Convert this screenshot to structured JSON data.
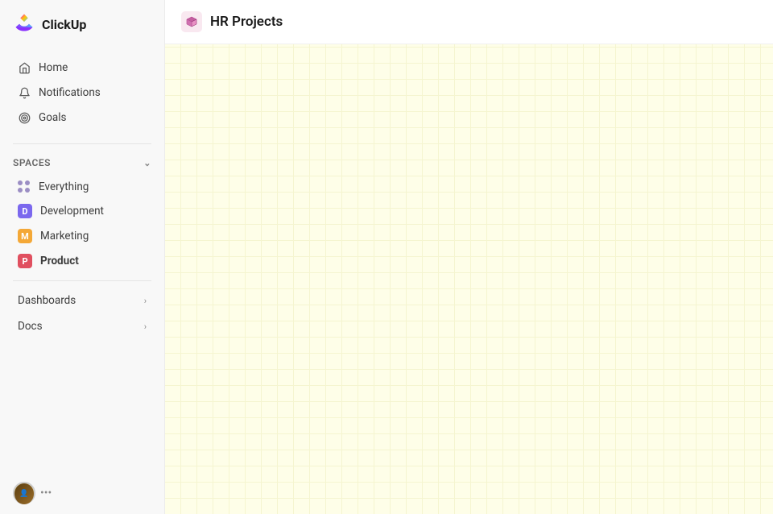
{
  "app": {
    "name": "ClickUp"
  },
  "sidebar": {
    "logo_text": "ClickUp",
    "nav_items": [
      {
        "id": "home",
        "label": "Home",
        "icon": "home-icon"
      },
      {
        "id": "notifications",
        "label": "Notifications",
        "icon": "bell-icon"
      },
      {
        "id": "goals",
        "label": "Goals",
        "icon": "goals-icon"
      }
    ],
    "spaces_label": "Spaces",
    "spaces": [
      {
        "id": "everything",
        "label": "Everything",
        "icon": "grid-icon",
        "color": null
      },
      {
        "id": "development",
        "label": "Development",
        "letter": "D",
        "color": "#7b68ee"
      },
      {
        "id": "marketing",
        "label": "Marketing",
        "letter": "M",
        "color": "#f4a837"
      },
      {
        "id": "product",
        "label": "Product",
        "letter": "P",
        "color": "#e04f5f",
        "active": true
      }
    ],
    "collapsibles": [
      {
        "id": "dashboards",
        "label": "Dashboards"
      },
      {
        "id": "docs",
        "label": "Docs"
      }
    ]
  },
  "main": {
    "header_title": "HR Projects",
    "header_icon": "hr-projects-icon"
  }
}
